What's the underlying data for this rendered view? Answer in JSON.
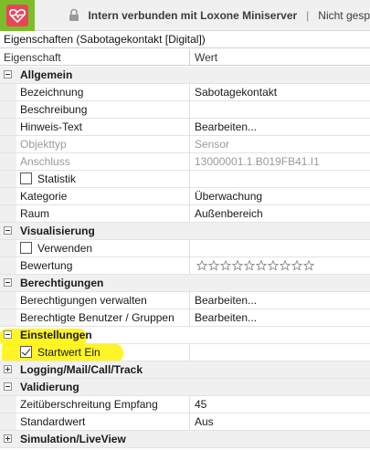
{
  "header": {
    "connection_text": "Intern verbunden mit Loxone Miniserver",
    "separator": "|",
    "status_text": "Nicht gesp"
  },
  "panel": {
    "title": "Eigenschaften (Sabotagekontakt [Digital])",
    "col_property": "Eigenschaft",
    "col_value": "Wert"
  },
  "categories": {
    "allgemein": "Allgemein",
    "visualisierung": "Visualisierung",
    "berechtigungen": "Berechtigungen",
    "einstellungen": "Einstellungen",
    "logging": "Logging/Mail/Call/Track",
    "validierung": "Validierung",
    "simulation": "Simulation/LiveView"
  },
  "rows": {
    "bezeichnung": {
      "name": "Bezeichnung",
      "value": "Sabotagekontakt"
    },
    "beschreibung": {
      "name": "Beschreibung",
      "value": ""
    },
    "hinweis": {
      "name": "Hinweis-Text",
      "value": "Bearbeiten..."
    },
    "objekttyp": {
      "name": "Objekttyp",
      "value": "Sensor"
    },
    "anschluss": {
      "name": "Anschluss",
      "value": "13000001.1.B019FB41.I1"
    },
    "statistik": {
      "name": "Statistik",
      "checked": false
    },
    "kategorie": {
      "name": "Kategorie",
      "value": "Überwachung"
    },
    "raum": {
      "name": "Raum",
      "value": "Außenbereich"
    },
    "verwenden": {
      "name": "Verwenden",
      "checked": false
    },
    "bewertung": {
      "name": "Bewertung",
      "stars": 10,
      "filled": 0
    },
    "ber_verwalten": {
      "name": "Berechtigungen verwalten",
      "value": "Bearbeiten..."
    },
    "ber_benutzer": {
      "name": "Berechtigte Benutzer / Gruppen",
      "value": "Bearbeiten..."
    },
    "startwert": {
      "name": "Startwert Ein",
      "checked": true
    },
    "zeitueberschreitung": {
      "name": "Zeitüberschreitung Empfang",
      "value": "45"
    },
    "standardwert": {
      "name": "Standardwert",
      "value": "Aus"
    }
  },
  "colors": {
    "logo_green": "#7dbd2b",
    "logo_red": "#e84559",
    "highlight": "#fff200",
    "category_bg": "#f0f0f0"
  }
}
